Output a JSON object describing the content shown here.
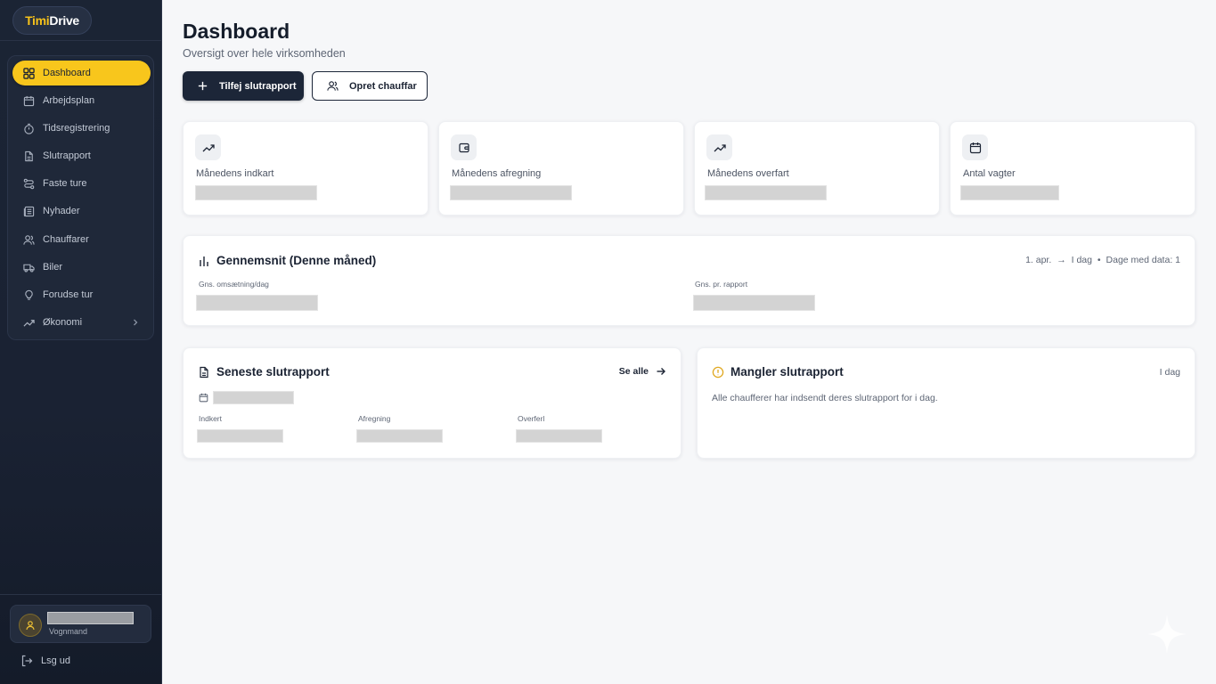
{
  "app": {
    "logo_part1": "Timi",
    "logo_part2": "Drive"
  },
  "sidebar": {
    "items": [
      {
        "label": "Dashboard",
        "icon": "dashboard-grid-icon",
        "active": true
      },
      {
        "label": "Arbejdsplan",
        "icon": "calendar-icon"
      },
      {
        "label": "Tidsregistrering",
        "icon": "timer-icon"
      },
      {
        "label": "Slutrapport",
        "icon": "document-icon"
      },
      {
        "label": "Faste ture",
        "icon": "route-icon"
      },
      {
        "label": "Nyhader",
        "icon": "newspaper-icon"
      },
      {
        "label": "Chauffarer",
        "icon": "users-icon"
      },
      {
        "label": "Biler",
        "icon": "truck-icon"
      },
      {
        "label": "Forudse tur",
        "icon": "lightbulb-icon"
      },
      {
        "label": "Økonomi",
        "icon": "trending-up-icon",
        "has_submenu": true
      }
    ],
    "user": {
      "role": "Vognmand"
    },
    "logout_label": "Lsg ud"
  },
  "header": {
    "title": "Dashboard",
    "subtitle": "Oversigt over hele virksomheden",
    "primary_button": "Tilfej slutrapport",
    "secondary_button": "Opret chauffar"
  },
  "stats": [
    {
      "label": "Månedens indkart",
      "icon": "trending-up-icon"
    },
    {
      "label": "Månedens afregning",
      "icon": "wallet-icon"
    },
    {
      "label": "Månedens overfart",
      "icon": "trending-up-icon"
    },
    {
      "label": "Antal vagter",
      "icon": "calendar-icon"
    }
  ],
  "averages": {
    "title": "Gennemsnit (Denne måned)",
    "range_start": "1. apr.",
    "range_end": "I dag",
    "days_with_data": "Dage med data: 1",
    "label_per_day": "Gns. omsætning/dag",
    "label_per_report": "Gns. pr. rapport"
  },
  "latest_report": {
    "title": "Seneste slutrapport",
    "see_all": "Se alle",
    "col_income": "Indkert",
    "col_settlement": "Afregning",
    "col_transferred": "Overferl"
  },
  "missing_report": {
    "title": "Mangler slutrapport",
    "date": "I dag",
    "message": "Alle chaufferer har indsendt deres slutrapport for i dag."
  },
  "colors": {
    "accent": "#f8c61c",
    "sidebar_bg": "#1b2434",
    "primary_button": "#1c2638"
  }
}
